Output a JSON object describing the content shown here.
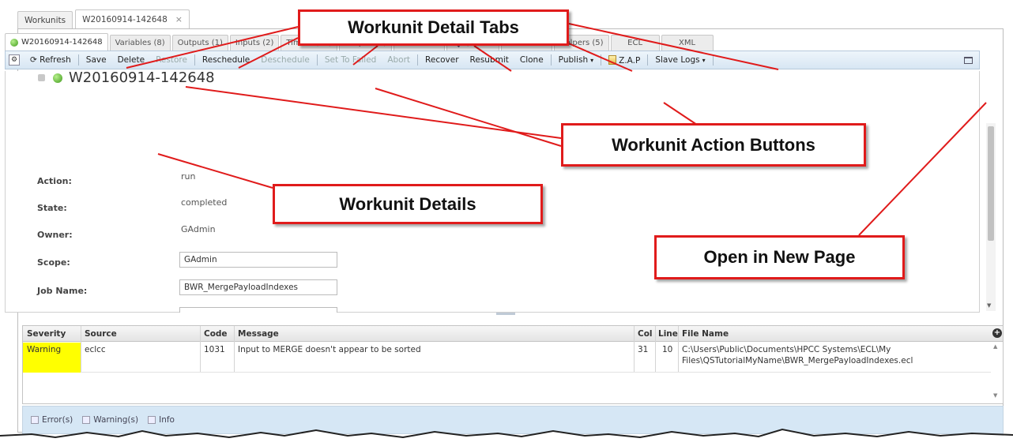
{
  "outer_tabs": [
    {
      "label": "Workunits",
      "closable": false
    },
    {
      "label": "W20160914-142648",
      "closable": true,
      "close_glyph": "×"
    }
  ],
  "inner_tabs": [
    {
      "label": "W20160914-142648",
      "icon": "status-ok-icon"
    },
    {
      "label": "Variables (8)"
    },
    {
      "label": "Outputs (1)"
    },
    {
      "label": "Inputs (2)"
    },
    {
      "label": "Timers (18)"
    },
    {
      "label": "Graphs (1)"
    },
    {
      "label": "Workflows"
    },
    {
      "label": "Queries",
      "icon": "search-icon"
    },
    {
      "label": "Resources"
    },
    {
      "label": "Helpers (5)"
    },
    {
      "label": "ECL"
    },
    {
      "label": "XML"
    }
  ],
  "toolbar": {
    "refresh": "Refresh",
    "save": "Save",
    "delete": "Delete",
    "restore": "Restore",
    "reschedule": "Reschedule",
    "deschedule": "Deschedule",
    "set_to_failed": "Set To Failed",
    "abort": "Abort",
    "recover": "Recover",
    "resubmit": "Resubmit",
    "clone": "Clone",
    "publish": "Publish",
    "zap": "Z.A.P",
    "slave_logs": "Slave Logs",
    "caret": "▾"
  },
  "workunit": {
    "title": "W20160914-142648",
    "fields": [
      {
        "label": "Action:",
        "value": "run"
      },
      {
        "label": "State:",
        "value": "completed"
      },
      {
        "label": "Owner:",
        "value": "GAdmin"
      },
      {
        "label": "Scope:",
        "value": "GAdmin"
      },
      {
        "label": "Job Name:",
        "value": "BWR_MergePayloadIndexes"
      }
    ]
  },
  "errors_grid": {
    "columns": [
      "Severity",
      "Source",
      "Code",
      "Message",
      "Col",
      "Line",
      "File Name"
    ],
    "rows": [
      {
        "severity": "Warning",
        "source": "eclcc",
        "code": "1031",
        "message": "Input to MERGE doesn't appear to be sorted",
        "col": "31",
        "line": "10",
        "file_line1": "C:\\Users\\Public\\Documents\\HPCC Systems\\ECL\\My",
        "file_line2": "Files\\QSTutorialMyName\\BWR_MergePayloadIndexes.ecl"
      }
    ],
    "add_glyph": "+"
  },
  "filters": [
    "Error(s)",
    "Warning(s)",
    "Info"
  ],
  "callouts": {
    "detail_tabs": "Workunit Detail Tabs",
    "action_buttons": "Workunit Action Buttons",
    "details": "Workunit Details",
    "new_page": "Open in New Page"
  },
  "colors": {
    "callout_border": "#e01b1b",
    "warning_highlight": "#ffff00",
    "toolbar_bg": "#d7e6f3"
  }
}
